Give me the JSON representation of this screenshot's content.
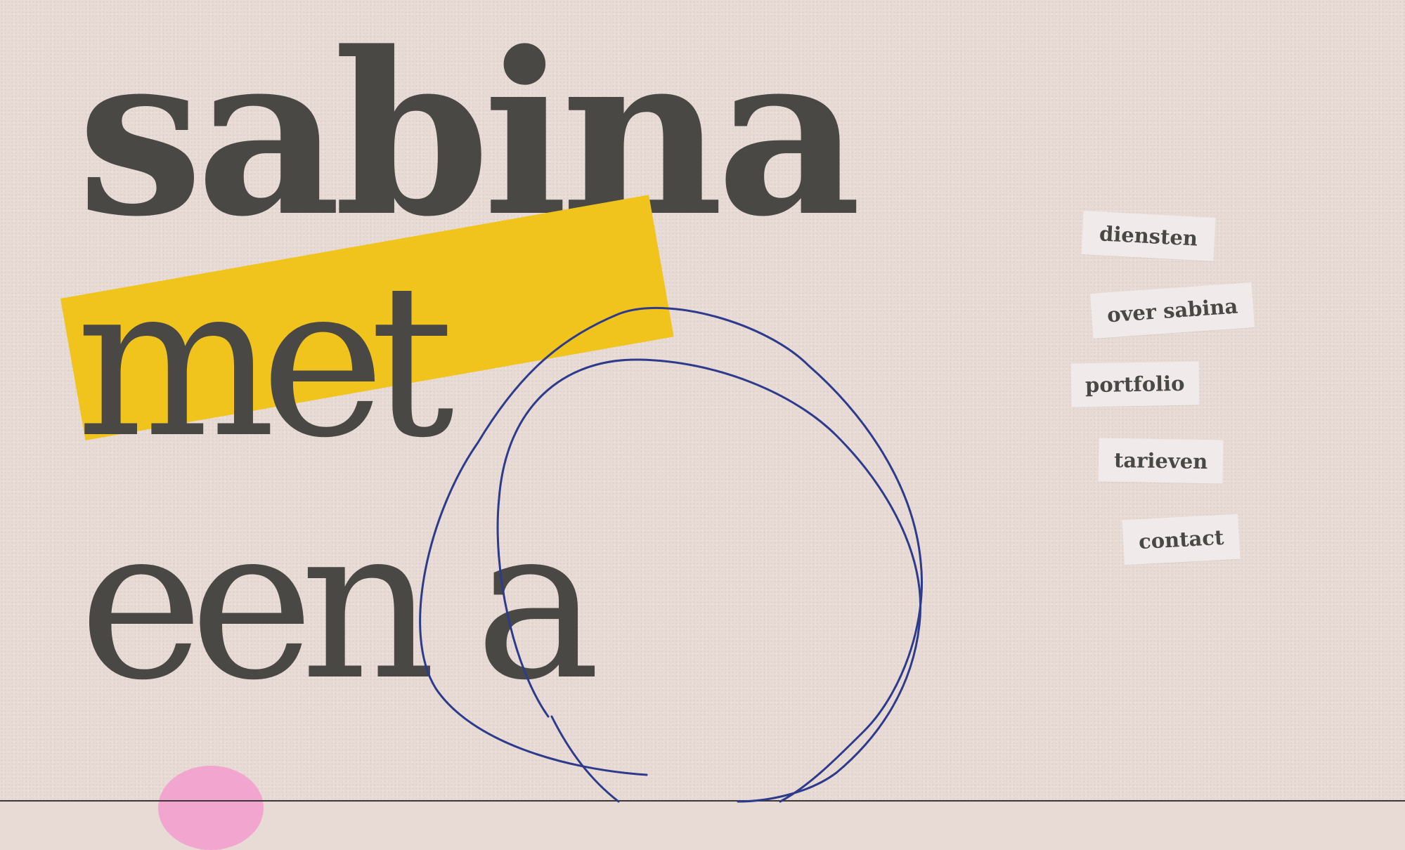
{
  "hero": {
    "line1": "sabina",
    "line2": "met",
    "line3": "een a"
  },
  "nav": {
    "items": [
      {
        "label": "diensten"
      },
      {
        "label": "over sabina"
      },
      {
        "label": "portfolio"
      },
      {
        "label": "tarieven"
      },
      {
        "label": "contact"
      }
    ]
  },
  "colors": {
    "background": "#e8dbd5",
    "text": "#4a4845",
    "highlight": "#f0c31d",
    "scribble": "#2e3a8c",
    "accent_pink": "#f2a5cf",
    "nav_tag": "#f0ebea"
  }
}
